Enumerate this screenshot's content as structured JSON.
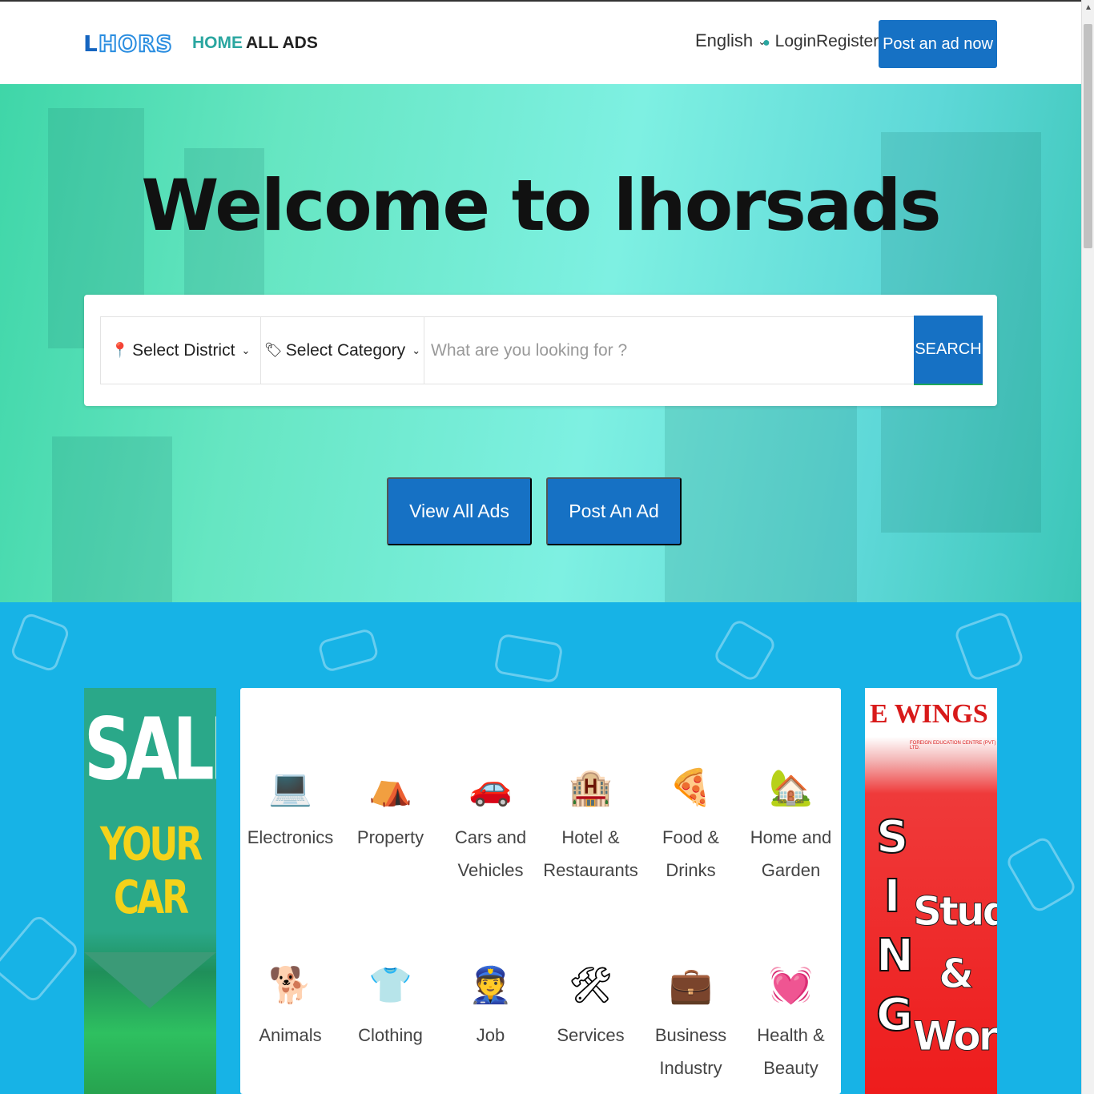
{
  "header": {
    "logo_l": "L",
    "logo_hors": "HORS",
    "nav": {
      "home": "HOME",
      "all_ads": "ALL ADS"
    },
    "language": "English",
    "login": "Login",
    "register": "Register",
    "post_now": "Post an ad now"
  },
  "hero": {
    "title": "Welcome to lhorsads",
    "search": {
      "district": "Select District",
      "category": "Select Category",
      "placeholder": "What are you looking for ?",
      "button": "SEARCH"
    },
    "view_all": "View All Ads",
    "post_ad": "Post An Ad"
  },
  "ads": {
    "left": {
      "line1": "SALE",
      "line2": "YOUR CAR"
    },
    "right": {
      "brand": "E WINGS",
      "brand_sub": "FOREIGN EDUCATION CENTRE (PVT) LTD.",
      "vertical": "SING",
      "study": "Study",
      "amp": "&",
      "work": "Work"
    }
  },
  "categories": [
    {
      "label": "Electronics",
      "icon": "laptop-icon",
      "emoji": "💻"
    },
    {
      "label": "Property",
      "icon": "tent-icon",
      "emoji": "⛺"
    },
    {
      "label": "Cars and Vehicles",
      "icon": "car-icon",
      "emoji": "🚗"
    },
    {
      "label": "Hotel & Restaurants",
      "icon": "hotel-icon",
      "emoji": "🏨"
    },
    {
      "label": "Food & Drinks",
      "icon": "pizza-icon",
      "emoji": "🍕"
    },
    {
      "label": "Home and Garden",
      "icon": "house-garden-icon",
      "emoji": "🏡"
    },
    {
      "label": "Animals",
      "icon": "dog-icon",
      "emoji": "🐕"
    },
    {
      "label": "Clothing",
      "icon": "shirt-icon",
      "emoji": "👕"
    },
    {
      "label": "Job",
      "icon": "pilot-icon",
      "emoji": "👮"
    },
    {
      "label": "Services",
      "icon": "tools-icon",
      "emoji": "🛠"
    },
    {
      "label": "Business Industry",
      "icon": "briefcase-icon",
      "emoji": "💼"
    },
    {
      "label": "Health & Beauty",
      "icon": "heart-icon",
      "emoji": "💓"
    }
  ]
}
